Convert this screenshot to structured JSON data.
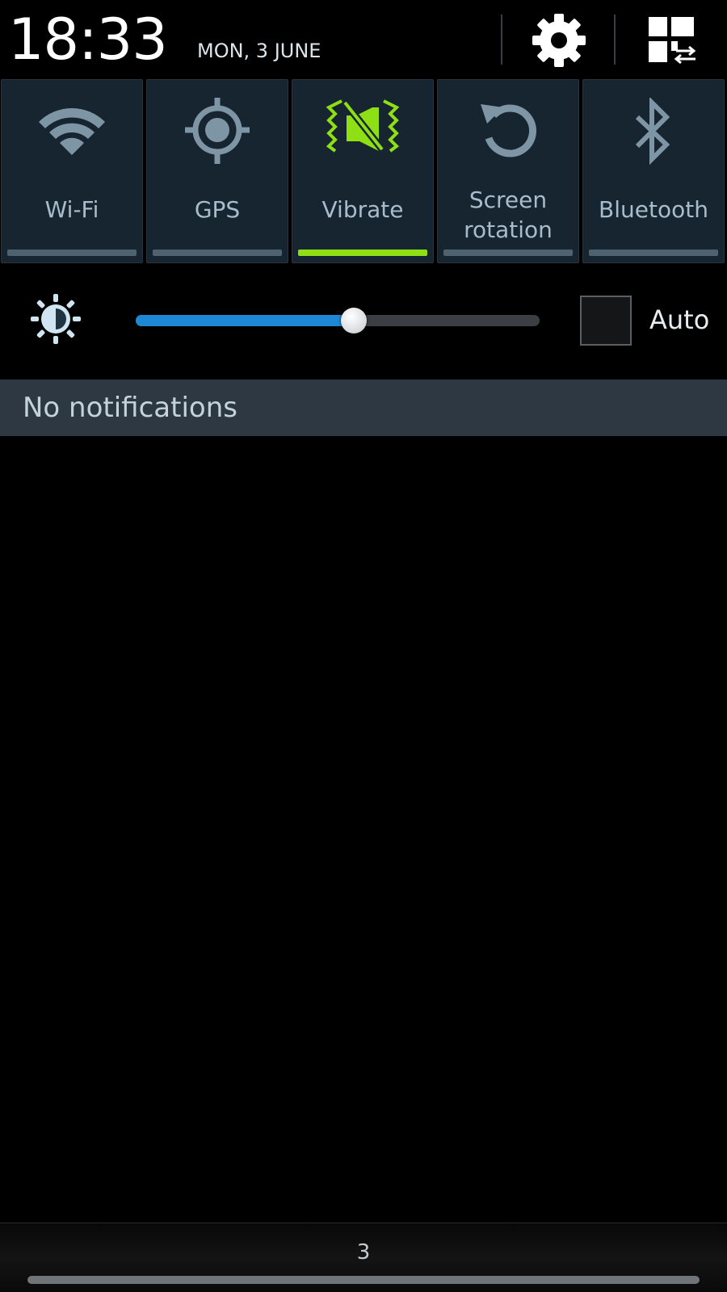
{
  "status": {
    "time": "18:33",
    "date": "MON, 3 JUNE"
  },
  "header_icons": [
    "gear-icon",
    "quick-panel-edit-icon"
  ],
  "toggles": [
    {
      "label": "Wi-Fi",
      "icon": "wifi-icon",
      "active": false
    },
    {
      "label": "GPS",
      "icon": "gps-icon",
      "active": false
    },
    {
      "label": "Vibrate",
      "icon": "vibrate-icon",
      "active": true
    },
    {
      "label_line1": "Screen",
      "label_line2": "rotation",
      "icon": "rotation-icon",
      "active": false
    },
    {
      "label": "Bluetooth",
      "icon": "bluetooth-icon",
      "active": false
    }
  ],
  "brightness": {
    "level_percent": 54,
    "auto_label": "Auto",
    "auto_checked": false
  },
  "notifications": {
    "header": "No notifications"
  },
  "footer": {
    "carrier_text": "3"
  },
  "colors": {
    "active_accent": "#8ee014",
    "slider_fill": "#1e88d4",
    "toggle_bg": "#16252f",
    "inactive_icon": "#7e95a6"
  }
}
